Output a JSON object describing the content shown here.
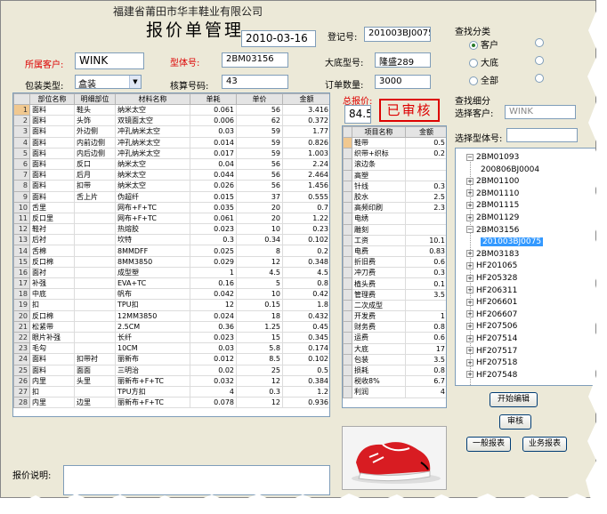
{
  "header": {
    "company": "福建省莆田市华丰鞋业有限公司",
    "title": "报价单管理"
  },
  "form": {
    "date": "2010-03-16",
    "reg_label": "登记号:",
    "reg_value": "201003BJ0075",
    "customer_label": "所属客户:",
    "customer_value": "WINK",
    "model_label": "型体号:",
    "model_value": "2BM03156",
    "sole_label": "大底型号:",
    "sole_value": "隆盛289",
    "pack_label": "包装类型:",
    "pack_value": "盒装",
    "size_label": "核算号码:",
    "size_value": "43",
    "order_label": "订单数量:",
    "order_value": "3000",
    "total_label": "总报价:",
    "total_value": "84.5",
    "stamp": "已审核"
  },
  "main_table": {
    "headers": [
      "部位名称",
      "明细部位",
      "材料名称",
      "单耗",
      "单价",
      "金额"
    ],
    "rows": [
      [
        "面料",
        "鞋头",
        "纳米太空",
        "0.061",
        "56",
        "3.416"
      ],
      [
        "面料",
        "头饰",
        "双镜面太空",
        "0.006",
        "62",
        "0.372"
      ],
      [
        "面料",
        "外边侧",
        "冲孔纳米太空",
        "0.03",
        "59",
        "1.77"
      ],
      [
        "面料",
        "内前边侧",
        "冲孔纳米太空",
        "0.014",
        "59",
        "0.826"
      ],
      [
        "面料",
        "内后边侧",
        "冲孔纳米太空",
        "0.017",
        "59",
        "1.003"
      ],
      [
        "面料",
        "反口",
        "纳米太空",
        "0.04",
        "56",
        "2.24"
      ],
      [
        "面料",
        "后月",
        "纳米太空",
        "0.044",
        "56",
        "2.464"
      ],
      [
        "面料",
        "扣带",
        "纳米太空",
        "0.026",
        "56",
        "1.456"
      ],
      [
        "面料",
        "舌上片",
        "伪超纤",
        "0.015",
        "37",
        "0.555"
      ],
      [
        "舌里",
        "",
        "网布+F+TC",
        "0.035",
        "20",
        "0.7"
      ],
      [
        "反口里",
        "",
        "网布+F+TC",
        "0.061",
        "20",
        "1.22"
      ],
      [
        "鞋衬",
        "",
        "热熔胶",
        "0.023",
        "10",
        "0.23"
      ],
      [
        "后衬",
        "",
        "坎特",
        "0.3",
        "0.34",
        "0.102"
      ],
      [
        "舌棉",
        "",
        "8MMDFF",
        "0.025",
        "8",
        "0.2"
      ],
      [
        "反口棉",
        "",
        "8MM3850",
        "0.029",
        "12",
        "0.348"
      ],
      [
        "面衬",
        "",
        "成型塑",
        "1",
        "4.5",
        "4.5"
      ],
      [
        "补强",
        "",
        "EVA+TC",
        "0.16",
        "5",
        "0.8"
      ],
      [
        "中底",
        "",
        "帆布",
        "0.042",
        "10",
        "0.42"
      ],
      [
        "扣",
        "",
        "TPU扣",
        "12",
        "0.15",
        "1.8"
      ],
      [
        "反口棉",
        "",
        "12MM3850",
        "0.024",
        "18",
        "0.432"
      ],
      [
        "松紧带",
        "",
        "2.5CM",
        "0.36",
        "1.25",
        "0.45"
      ],
      [
        "眼片补强",
        "",
        "长纤",
        "0.023",
        "15",
        "0.345"
      ],
      [
        "毛勾",
        "",
        "10CM",
        "0.03",
        "5.8",
        "0.174"
      ],
      [
        "面料",
        "扣带衬",
        "丽新布",
        "0.012",
        "8.5",
        "0.102"
      ],
      [
        "面料",
        "面面",
        "三明治",
        "0.02",
        "25",
        "0.5"
      ],
      [
        "内里",
        "头里",
        "丽新布+F+TC",
        "0.032",
        "12",
        "0.384"
      ],
      [
        "扣",
        "",
        "TPU方扣",
        "4",
        "0.3",
        "1.2"
      ],
      [
        "内里",
        "边里",
        "丽新布+F+TC",
        "0.078",
        "12",
        "0.936"
      ]
    ]
  },
  "fee_table": {
    "headers": [
      "项目名称",
      "金额"
    ],
    "rows": [
      [
        "鞋带",
        "0.5"
      ],
      [
        "织带+织标",
        "0.2"
      ],
      [
        "滚边条",
        ""
      ],
      [
        "高塑",
        ""
      ],
      [
        "针线",
        "0.3"
      ],
      [
        "胶水",
        "2.5"
      ],
      [
        "高频印刷",
        "2.3"
      ],
      [
        "电绣",
        ""
      ],
      [
        "雕刻",
        ""
      ],
      [
        "工资",
        "10.1"
      ],
      [
        "电费",
        "0.83"
      ],
      [
        "折旧费",
        "0.6"
      ],
      [
        "冲刀费",
        "0.3"
      ],
      [
        "植头费",
        "0.1"
      ],
      [
        "管理费",
        "3.5"
      ],
      [
        "二次成型",
        ""
      ],
      [
        "开发费",
        "1"
      ],
      [
        "财务费",
        "0.8"
      ],
      [
        "运费",
        "0.6"
      ],
      [
        "大底",
        "17"
      ],
      [
        "包装",
        "3.5"
      ],
      [
        "损耗",
        "0.8"
      ],
      [
        "税收8%",
        "6.7"
      ],
      [
        "利润",
        "4"
      ]
    ]
  },
  "right_panel": {
    "cat_title": "查找分类",
    "radios": [
      "客户",
      "大底",
      "全部"
    ],
    "detail_title": "查找细分",
    "select_customer_label": "选择客户:",
    "select_customer_value": "WINK",
    "select_model_label": "选择型体号:",
    "tree": [
      {
        "label": "2BM01093",
        "open": true
      },
      {
        "label": "200806BJ0004",
        "child": true
      },
      {
        "label": "2BM01100"
      },
      {
        "label": "2BM01110"
      },
      {
        "label": "2BM01115"
      },
      {
        "label": "2BM01129"
      },
      {
        "label": "2BM03156",
        "open": true
      },
      {
        "label": "201003BJ0075",
        "child": true,
        "selected": true
      },
      {
        "label": "2BM03183"
      },
      {
        "label": "HF201065"
      },
      {
        "label": "HF205328"
      },
      {
        "label": "HF206311"
      },
      {
        "label": "HF206601"
      },
      {
        "label": "HF206607"
      },
      {
        "label": "HF207506"
      },
      {
        "label": "HF207514"
      },
      {
        "label": "HF207517"
      },
      {
        "label": "HF207518"
      },
      {
        "label": "HF207548"
      }
    ],
    "btn_edit": "开始编辑",
    "btn_audit": "审核",
    "btn_general": "一般报表",
    "btn_business": "业务报表"
  },
  "footer": {
    "note_label": "报价说明:"
  }
}
